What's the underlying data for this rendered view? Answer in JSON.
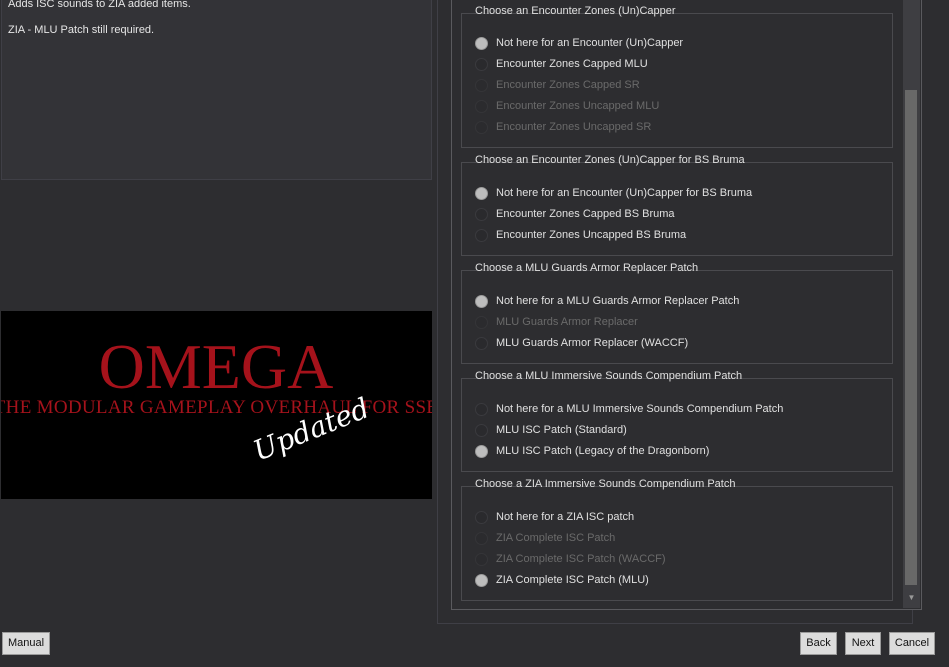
{
  "description": {
    "line1": "Adds ISC sounds to ZIA added items.",
    "line2": "ZIA - MLU Patch still required."
  },
  "banner": {
    "title": "OMEGA",
    "subtitle": "THE MODULAR GAMEPLAY OVERHAUL FOR SSE",
    "stamp": "Updated"
  },
  "groups": [
    {
      "title": "Choose an Encounter Zones (Un)Capper",
      "options": [
        {
          "label": "Not here for an Encounter (Un)Capper",
          "checked": true,
          "disabled": false
        },
        {
          "label": "Encounter Zones Capped MLU",
          "checked": false,
          "disabled": false
        },
        {
          "label": "Encounter Zones Capped SR",
          "checked": false,
          "disabled": true
        },
        {
          "label": "Encounter Zones Uncapped MLU",
          "checked": false,
          "disabled": true
        },
        {
          "label": "Encounter Zones Uncapped SR",
          "checked": false,
          "disabled": true
        }
      ]
    },
    {
      "title": "Choose an Encounter Zones (Un)Capper for BS Bruma",
      "options": [
        {
          "label": "Not here for an Encounter (Un)Capper for BS Bruma",
          "checked": true,
          "disabled": false
        },
        {
          "label": "Encounter Zones Capped BS Bruma",
          "checked": false,
          "disabled": false
        },
        {
          "label": "Encounter Zones Uncapped BS Bruma",
          "checked": false,
          "disabled": false
        }
      ]
    },
    {
      "title": "Choose a MLU Guards Armor Replacer Patch",
      "options": [
        {
          "label": "Not here for a MLU Guards Armor Replacer Patch",
          "checked": true,
          "disabled": false
        },
        {
          "label": "MLU Guards Armor Replacer",
          "checked": false,
          "disabled": true
        },
        {
          "label": "MLU Guards Armor Replacer (WACCF)",
          "checked": false,
          "disabled": false
        }
      ]
    },
    {
      "title": "Choose a MLU Immersive Sounds Compendium Patch",
      "options": [
        {
          "label": "Not here for a MLU Immersive Sounds Compendium Patch",
          "checked": false,
          "disabled": false
        },
        {
          "label": "MLU ISC Patch (Standard)",
          "checked": false,
          "disabled": false
        },
        {
          "label": "MLU ISC Patch (Legacy of the Dragonborn)",
          "checked": true,
          "disabled": false
        }
      ]
    },
    {
      "title": "Choose a ZIA Immersive Sounds Compendium Patch",
      "options": [
        {
          "label": "Not here for a ZIA ISC patch",
          "checked": false,
          "disabled": false
        },
        {
          "label": "ZIA Complete ISC Patch",
          "checked": false,
          "disabled": true
        },
        {
          "label": "ZIA Complete ISC Patch (WACCF)",
          "checked": false,
          "disabled": true
        },
        {
          "label": "ZIA Complete ISC Patch (MLU)",
          "checked": true,
          "disabled": false
        }
      ]
    }
  ],
  "buttons": {
    "manual": "Manual",
    "back": "Back",
    "next": "Next",
    "cancel": "Cancel"
  },
  "colors": {
    "window_bg": "#2d2d30",
    "banner_red": "#a5121b",
    "radio_checked": "#bdbdbd",
    "disabled_text": "#6a6a6a"
  }
}
